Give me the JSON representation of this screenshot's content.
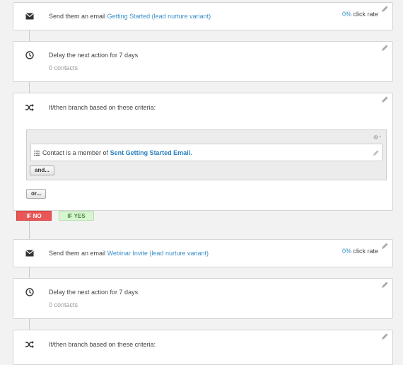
{
  "steps": [
    {
      "type": "email",
      "prefix": "Send them an email",
      "link": "Getting Started (lead nurture variant)",
      "rate_value": "0%",
      "rate_label": "click rate"
    },
    {
      "type": "delay",
      "title": "Delay the next action for 7 days",
      "sub": "0 contacts"
    },
    {
      "type": "branch",
      "title": "If/then branch based on these criteria:",
      "condition_prefix": "Contact is a member of",
      "condition_link": "Sent Getting Started Email.",
      "and_label": "and...",
      "or_label": "or..."
    },
    {
      "type": "email",
      "prefix": "Send them an email",
      "link": "Webinar Invite (lead nurture variant)",
      "rate_value": "0%",
      "rate_label": "click rate"
    },
    {
      "type": "delay",
      "title": "Delay the next action for 7 days",
      "sub": "0 contacts"
    },
    {
      "type": "branch",
      "title": "If/then branch based on these criteria:"
    }
  ],
  "branch_tags": {
    "no": "IF NO",
    "yes": "IF YES"
  },
  "colors": {
    "accent": "#3a8ec8",
    "no_bg": "#e95656",
    "yes_bg": "#d6f5d0"
  },
  "icons": {
    "email": "envelope-icon",
    "delay": "clock-icon",
    "branch": "shuffle-icon",
    "edit": "pencil-icon",
    "settings": "gear-icon",
    "list": "list-icon"
  }
}
